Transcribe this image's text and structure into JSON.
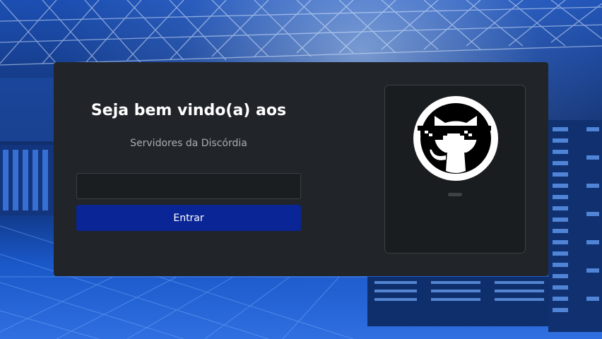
{
  "login": {
    "title": "Seja bem vindo(a) aos",
    "subtitle": "Servidores da Discórdia",
    "input_value": "",
    "input_placeholder": "",
    "submit_label": "Entrar"
  },
  "logo": {
    "icon": "github-octocat-with-pixel-sunglasses-icon"
  },
  "colors": {
    "card_background": "#212529",
    "button_background": "#0a2596",
    "background_accent": "#1f5fd6"
  }
}
